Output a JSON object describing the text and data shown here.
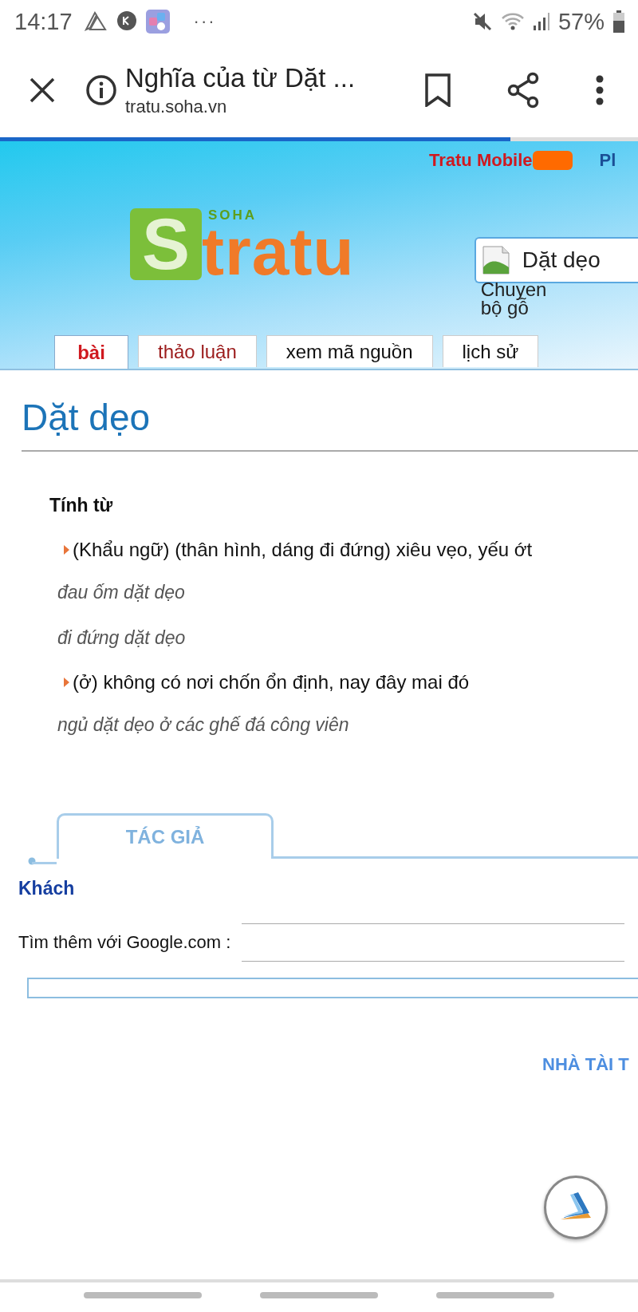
{
  "status_bar": {
    "time": "14:17",
    "notification_more": "···",
    "battery": "57%"
  },
  "toolbar": {
    "title": "Nghĩa của từ Dặt ...",
    "url": "tratu.soha.vn",
    "progress": {
      "level": 0.8
    }
  },
  "banner": {
    "top_link": "Tratu Mobile",
    "top_link_2": "Pl",
    "logo": {
      "small": "SOHA",
      "badge": "S",
      "word": "tratu"
    },
    "search": {
      "value": "Dặt dẹo"
    },
    "broken_image_alt": "Chuyen bộ gỗ"
  },
  "tabs": [
    {
      "label": "bài",
      "selected": true
    },
    {
      "label": "thảo luận",
      "selected": false
    },
    {
      "label": "xem mã nguồn",
      "selected": false
    },
    {
      "label": "lịch sử",
      "selected": false
    }
  ],
  "heading": "Dặt dẹo",
  "part_of_speech": "Tính từ",
  "senses": [
    {
      "definition": "(Khẩu ngữ) (thân hình, dáng đi đứng) xiêu vẹo, yếu ớt",
      "examples": [
        "đau ốm dặt dẹo",
        "đi đứng dặt dẹo"
      ]
    },
    {
      "definition": "(ở) không có nơi chốn ổn định, nay đây mai đó",
      "examples": [
        "ngủ dặt dẹo ở các ghế đá công viên"
      ]
    }
  ],
  "author_tab": "TÁC GIẢ",
  "author": "Khách",
  "google_label": "Tìm thêm với Google.com :",
  "sponsor": "NHÀ TÀI T"
}
